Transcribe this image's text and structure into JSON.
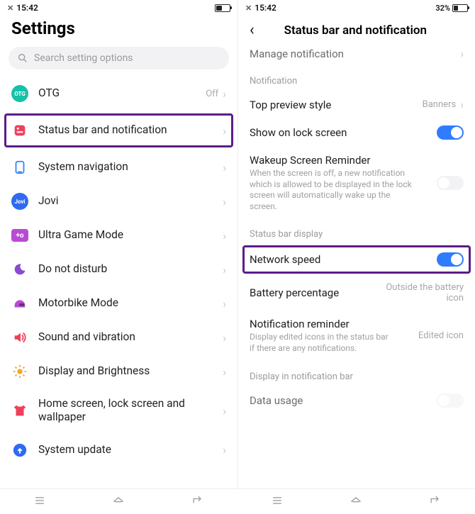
{
  "left": {
    "status": {
      "time": "15:42"
    },
    "title": "Settings",
    "search_placeholder": "Search setting options",
    "items": [
      {
        "name": "otg",
        "label": "OTG",
        "value": "Off",
        "icon": "otg",
        "color": "#14c2a9",
        "text": "OTG"
      },
      {
        "name": "status-bar",
        "label": "Status bar and notification",
        "value": "",
        "icon": "status",
        "color": "#ef3f5a",
        "highlighted": true
      },
      {
        "name": "sys-nav",
        "label": "System navigation",
        "value": "",
        "icon": "nav",
        "color": "#3b82f6"
      },
      {
        "name": "jovi",
        "label": "Jovi",
        "value": "",
        "icon": "jovi",
        "color": "#2f6bf0",
        "text": "Jovi"
      },
      {
        "name": "ultra-game",
        "label": "Ultra Game Mode",
        "value": "",
        "icon": "game",
        "color": "#b84bd3",
        "text": "+o"
      },
      {
        "name": "dnd",
        "label": "Do not disturb",
        "value": "",
        "icon": "moon",
        "color": "#8a4bd3"
      },
      {
        "name": "motorbike",
        "label": "Motorbike Mode",
        "value": "",
        "icon": "helmet",
        "color": "#b84bd3"
      },
      {
        "name": "sound",
        "label": "Sound and vibration",
        "value": "",
        "icon": "sound",
        "color": "#ef3f5a"
      },
      {
        "name": "display",
        "label": "Display and Brightness",
        "value": "",
        "icon": "sun",
        "color": "#f5a623"
      },
      {
        "name": "home",
        "label": "Home screen, lock screen and wallpaper",
        "value": "",
        "icon": "shirt",
        "color": "#ef3f5a"
      },
      {
        "name": "update",
        "label": "System update",
        "value": "",
        "icon": "update",
        "color": "#2f6bf0"
      }
    ]
  },
  "right": {
    "status": {
      "time": "15:42",
      "battery_text": "32%"
    },
    "header": "Status bar and notification",
    "top_truncated": "Manage notification",
    "sections": {
      "notification_label": "Notification",
      "top_preview": {
        "label": "Top preview style",
        "value": "Banners"
      },
      "lock_screen": {
        "label": "Show on lock screen",
        "on": true
      },
      "wakeup": {
        "label": "Wakeup Screen Reminder",
        "desc": "When the screen is off, a new notification which is allowed to be displayed in the lock screen will automatically wake up the screen.",
        "on": false
      },
      "status_bar_label": "Status bar display",
      "network_speed": {
        "label": "Network speed",
        "on": true
      },
      "battery_pct": {
        "label": "Battery percentage",
        "value": "Outside the battery icon"
      },
      "notif_reminder": {
        "label": "Notification reminder",
        "desc": "Display edited icons in the status bar if there are any notifications.",
        "value": "Edited icon"
      },
      "display_notif_label": "Display in notification bar",
      "data_usage": {
        "label": "Data usage",
        "on": false
      }
    }
  }
}
